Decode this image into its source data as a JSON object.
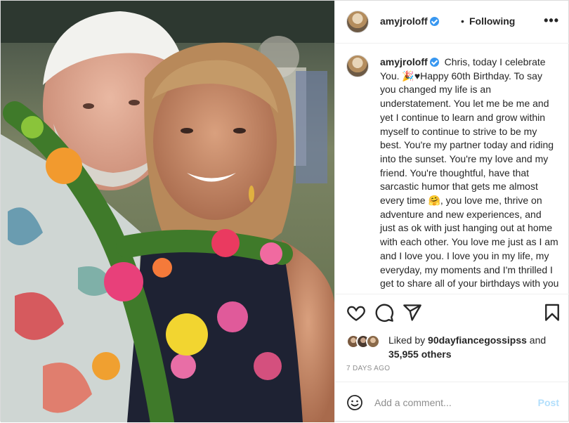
{
  "post": {
    "username": "amyjroloff",
    "follow_separator": "•",
    "follow_status": "Following",
    "more_glyph": "•••",
    "caption": {
      "username": "amyjroloff",
      "text": "Chris, today I celebrate You. 🎉♥Happy 60th Birthday. To say you changed my life is an understatement. You let me be me and yet I continue to learn and grow within myself to continue to strive to be my best. You're my partner today and riding into the sunset. You're my love and my friend. You're thoughtful, have that sarcastic humor that gets me almost every time 🤗, you love me, thrive on adventure and new experiences, and just as ok with just hanging out at home with each other. You love me just as I am and I love you. I love you in my life, my everyday, my moments and I'm thrilled I get to share all of your birthdays with you from here on out. It's your birthday"
    },
    "likes": {
      "prefix": "Liked by",
      "liker": "90dayfiancegossipss",
      "conjunction": "and",
      "others": "35,955 others"
    },
    "timestamp": "7 DAYS AGO",
    "comment_placeholder": "Add a comment...",
    "post_button": "Post"
  },
  "icons": {
    "like": "heart-icon",
    "comment": "comment-icon",
    "share": "paper-plane-icon",
    "save": "bookmark-icon",
    "emoji": "smiley-icon",
    "verified": "verified-badge-icon"
  },
  "colors": {
    "link_blue": "#3897f0",
    "post_disabled": "#b2dffc",
    "muted": "#8e8e8e",
    "text": "#262626"
  }
}
